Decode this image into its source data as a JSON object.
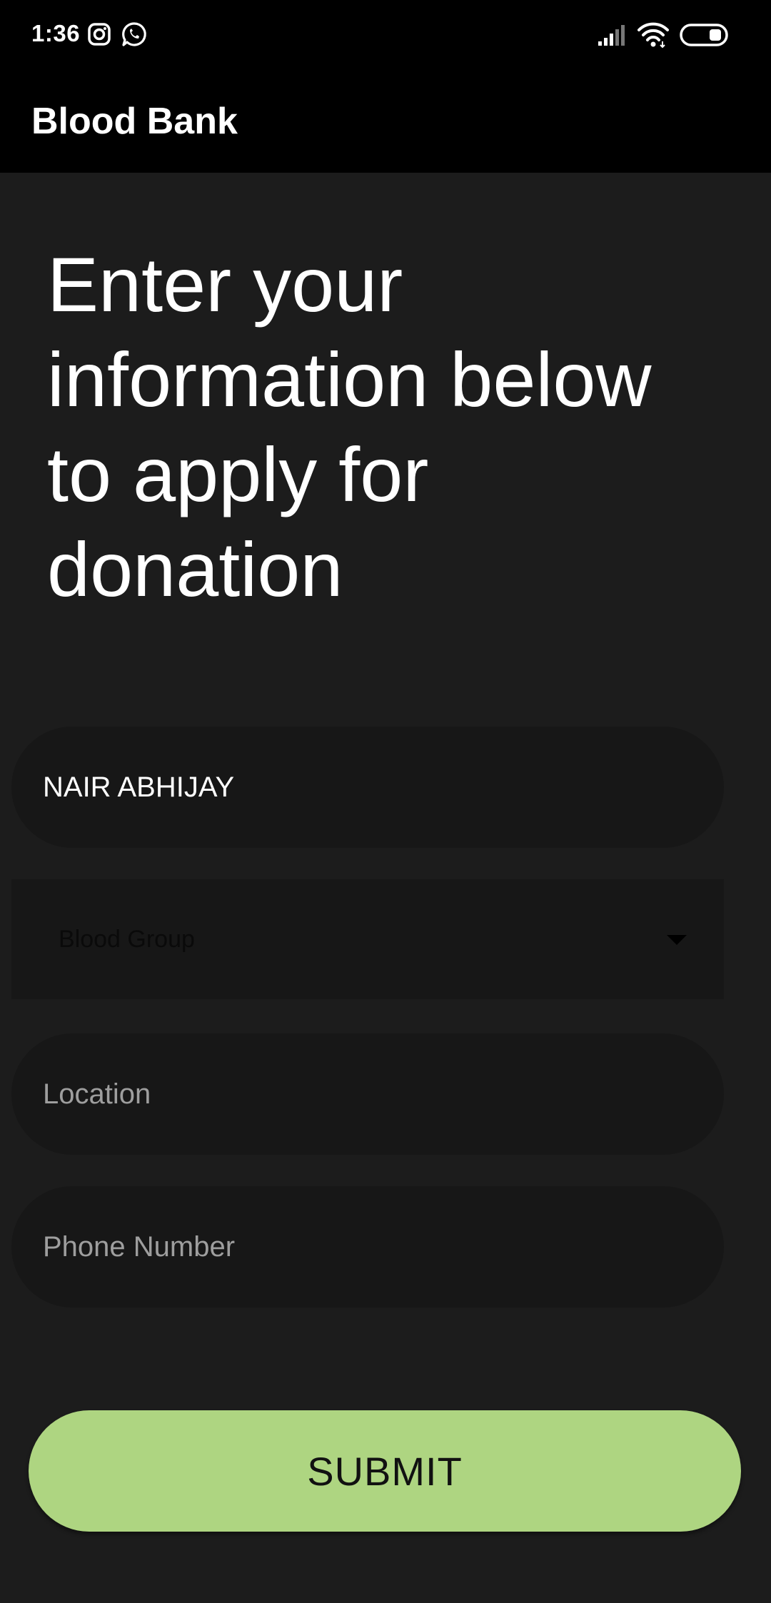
{
  "status_bar": {
    "time": "1:36",
    "icons_left": [
      "instagram-icon",
      "whatsapp-icon"
    ],
    "icons_right": [
      "cell-signal-icon",
      "wifi-icon",
      "battery-icon"
    ]
  },
  "app_bar": {
    "title": "Blood Bank"
  },
  "headline": "Enter your information below to apply for donation",
  "form": {
    "name_value": "NAIR ABHIJAY",
    "blood_group_placeholder": "Blood Group",
    "location_placeholder": "Location",
    "phone_placeholder": "Phone Number",
    "submit_label": "SUBMIT"
  },
  "colors": {
    "background": "#1c1c1c",
    "app_bar": "#000000",
    "field_background": "#171717",
    "submit_button": "#aed581"
  }
}
